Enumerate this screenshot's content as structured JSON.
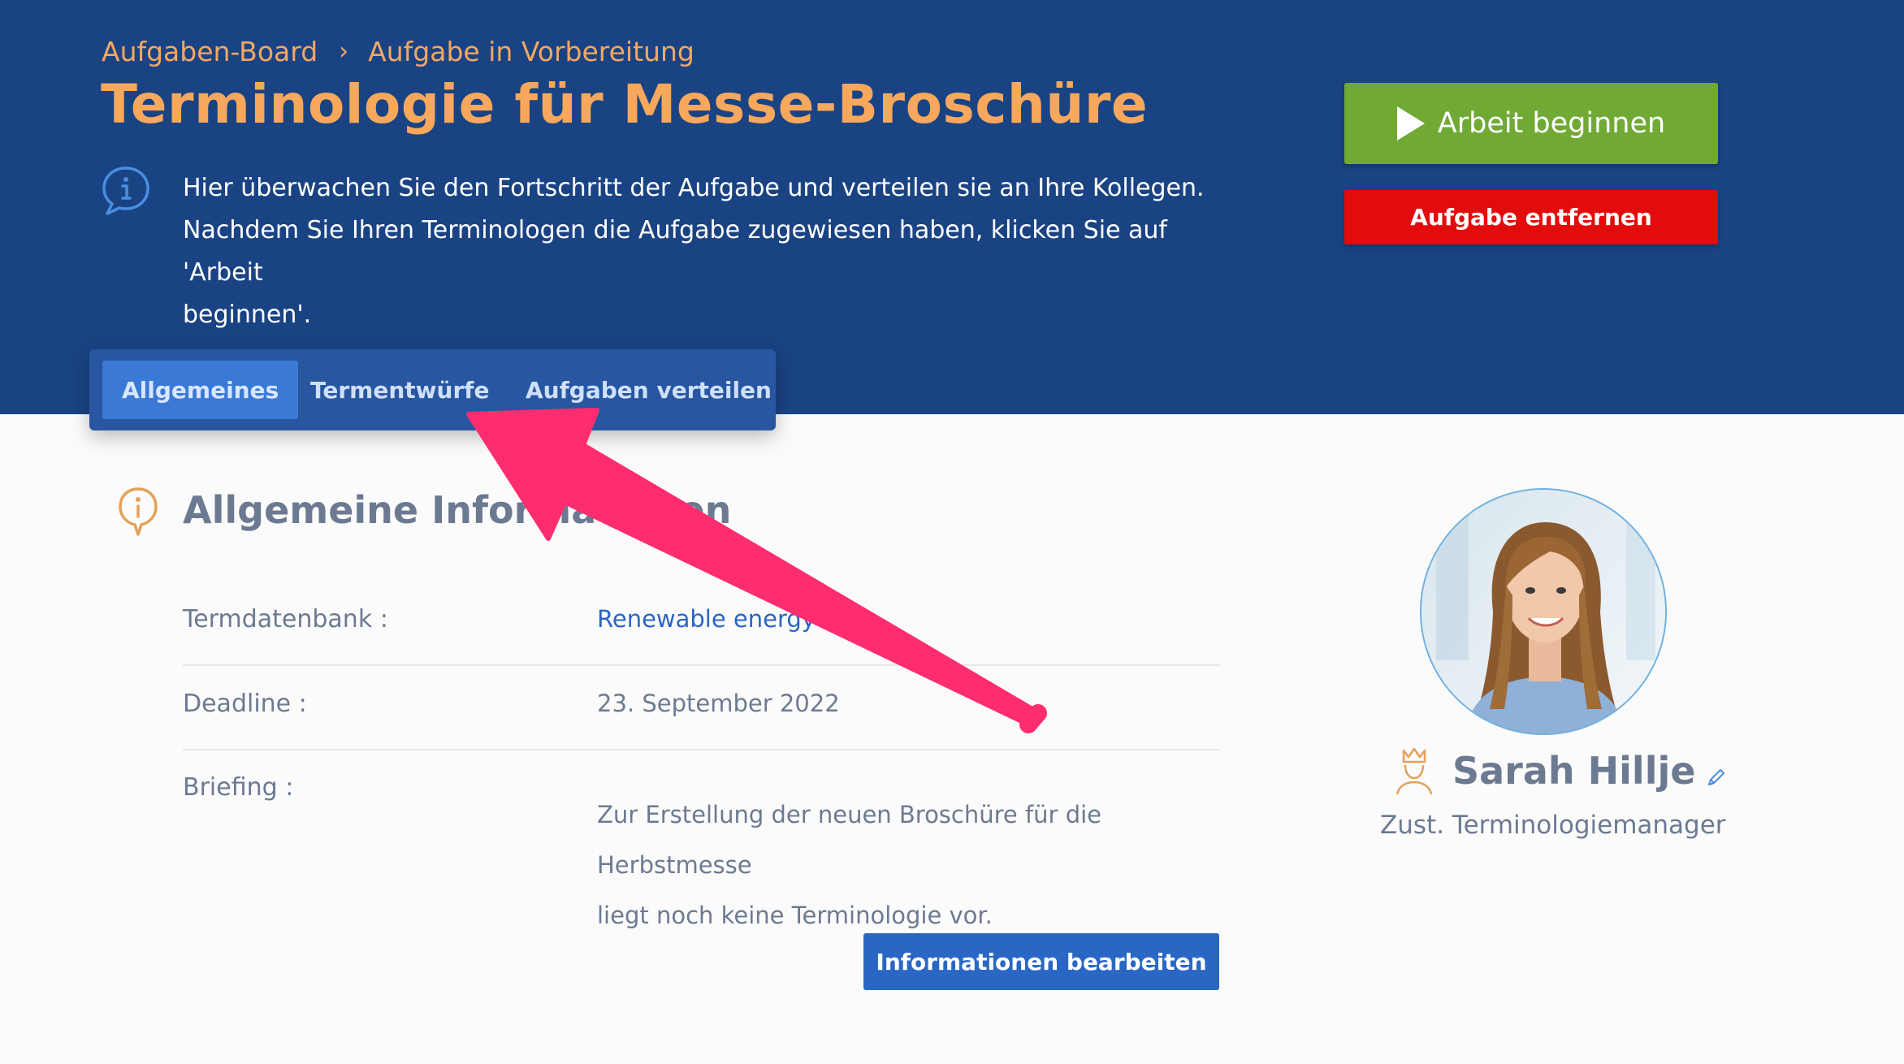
{
  "breadcrumb": {
    "items": [
      "Aufgaben-Board",
      "Aufgabe in Vorbereitung"
    ],
    "separator": "›"
  },
  "header": {
    "title": "Terminologie für Messe-Broschüre",
    "intro_line1": "Hier überwachen Sie den Fortschritt der Aufgabe und verteilen sie an Ihre Kollegen.",
    "intro_line2": "Nachdem Sie Ihren Terminologen die Aufgabe zugewiesen haben, klicken Sie auf 'Arbeit",
    "intro_line3": "beginnen'."
  },
  "actions": {
    "start_label": "Arbeit beginnen",
    "remove_label": "Aufgabe entfernen"
  },
  "tabs": [
    {
      "label": "Allgemeines",
      "active": true
    },
    {
      "label": "Termentwürfe",
      "active": false
    },
    {
      "label": "Aufgaben verteilen",
      "active": false
    }
  ],
  "section": {
    "title": "Allgemeine Informationen",
    "fields": {
      "termdb_label": "Termdatenbank :",
      "termdb_value": "Renewable energy",
      "deadline_label": "Deadline :",
      "deadline_value": "23. September 2022",
      "briefing_label": "Briefing :",
      "briefing_line1": "Zur Erstellung der neuen Broschüre für die Herbstmesse",
      "briefing_line2": "liegt noch keine Terminologie vor."
    },
    "edit_label": "Informationen bearbeiten"
  },
  "person": {
    "name": "Sarah Hillje",
    "role": "Zust. Terminologiemanager"
  },
  "colors": {
    "header_bg": "#1a4383",
    "title": "#f7a85c",
    "start_button": "#70aa35",
    "remove_button": "#e20c0c",
    "link": "#2a65c4",
    "annotation_arrow": "#ff2d6f"
  },
  "icons": [
    "chat-info-icon",
    "info-pin-icon",
    "play-icon",
    "crown-user-icon",
    "pencil-icon",
    "annotation-arrow"
  ]
}
